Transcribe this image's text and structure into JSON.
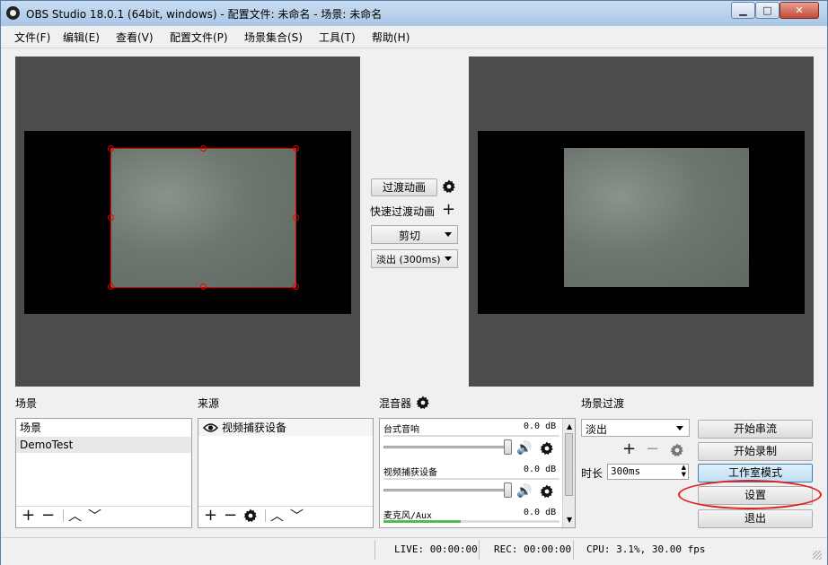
{
  "window": {
    "title": "OBS Studio 18.0.1 (64bit, windows) - 配置文件: 未命名 - 场景: 未命名",
    "minimize": "▁",
    "maximize": "□",
    "close": "✕"
  },
  "menu": [
    "文件(F)",
    "编辑(E)",
    "查看(V)",
    "配置文件(P)",
    "场景集合(S)",
    "工具(T)",
    "帮助(H)"
  ],
  "transition_center": {
    "transition_button": "过渡动画",
    "quick_transitions_label": "快速过渡动画",
    "cut_combo": "剪切",
    "fade_combo": "淡出 (300ms)"
  },
  "scenes": {
    "label": "场景",
    "items": [
      "场景",
      "DemoTest"
    ]
  },
  "sources": {
    "label": "来源",
    "items": [
      "视频捕获设备"
    ]
  },
  "mixer": {
    "label": "混音器",
    "channels": [
      {
        "name": "台式音响",
        "level": "0.0 dB"
      },
      {
        "name": "视频捕获设备",
        "level": "0.0 dB"
      },
      {
        "name": "麦克风/Aux",
        "level": "0.0 dB"
      }
    ]
  },
  "scene_transitions": {
    "label": "场景过渡",
    "selected": "淡出",
    "duration_label": "时长",
    "duration_value": "300ms"
  },
  "controls": {
    "start_streaming": "开始串流",
    "start_recording": "开始录制",
    "studio_mode": "工作室模式",
    "settings": "设置",
    "exit": "退出"
  },
  "status": {
    "live": "LIVE: 00:00:00",
    "rec": "REC: 00:00:00",
    "cpu": "CPU: 3.1%, 30.00 fps"
  },
  "colors": {
    "selection_red": "#e00000",
    "highlight_ellipse": "#e02020",
    "studio_mode_accent": "#3c7fb1",
    "preview_bg": "#4c4c4c"
  }
}
